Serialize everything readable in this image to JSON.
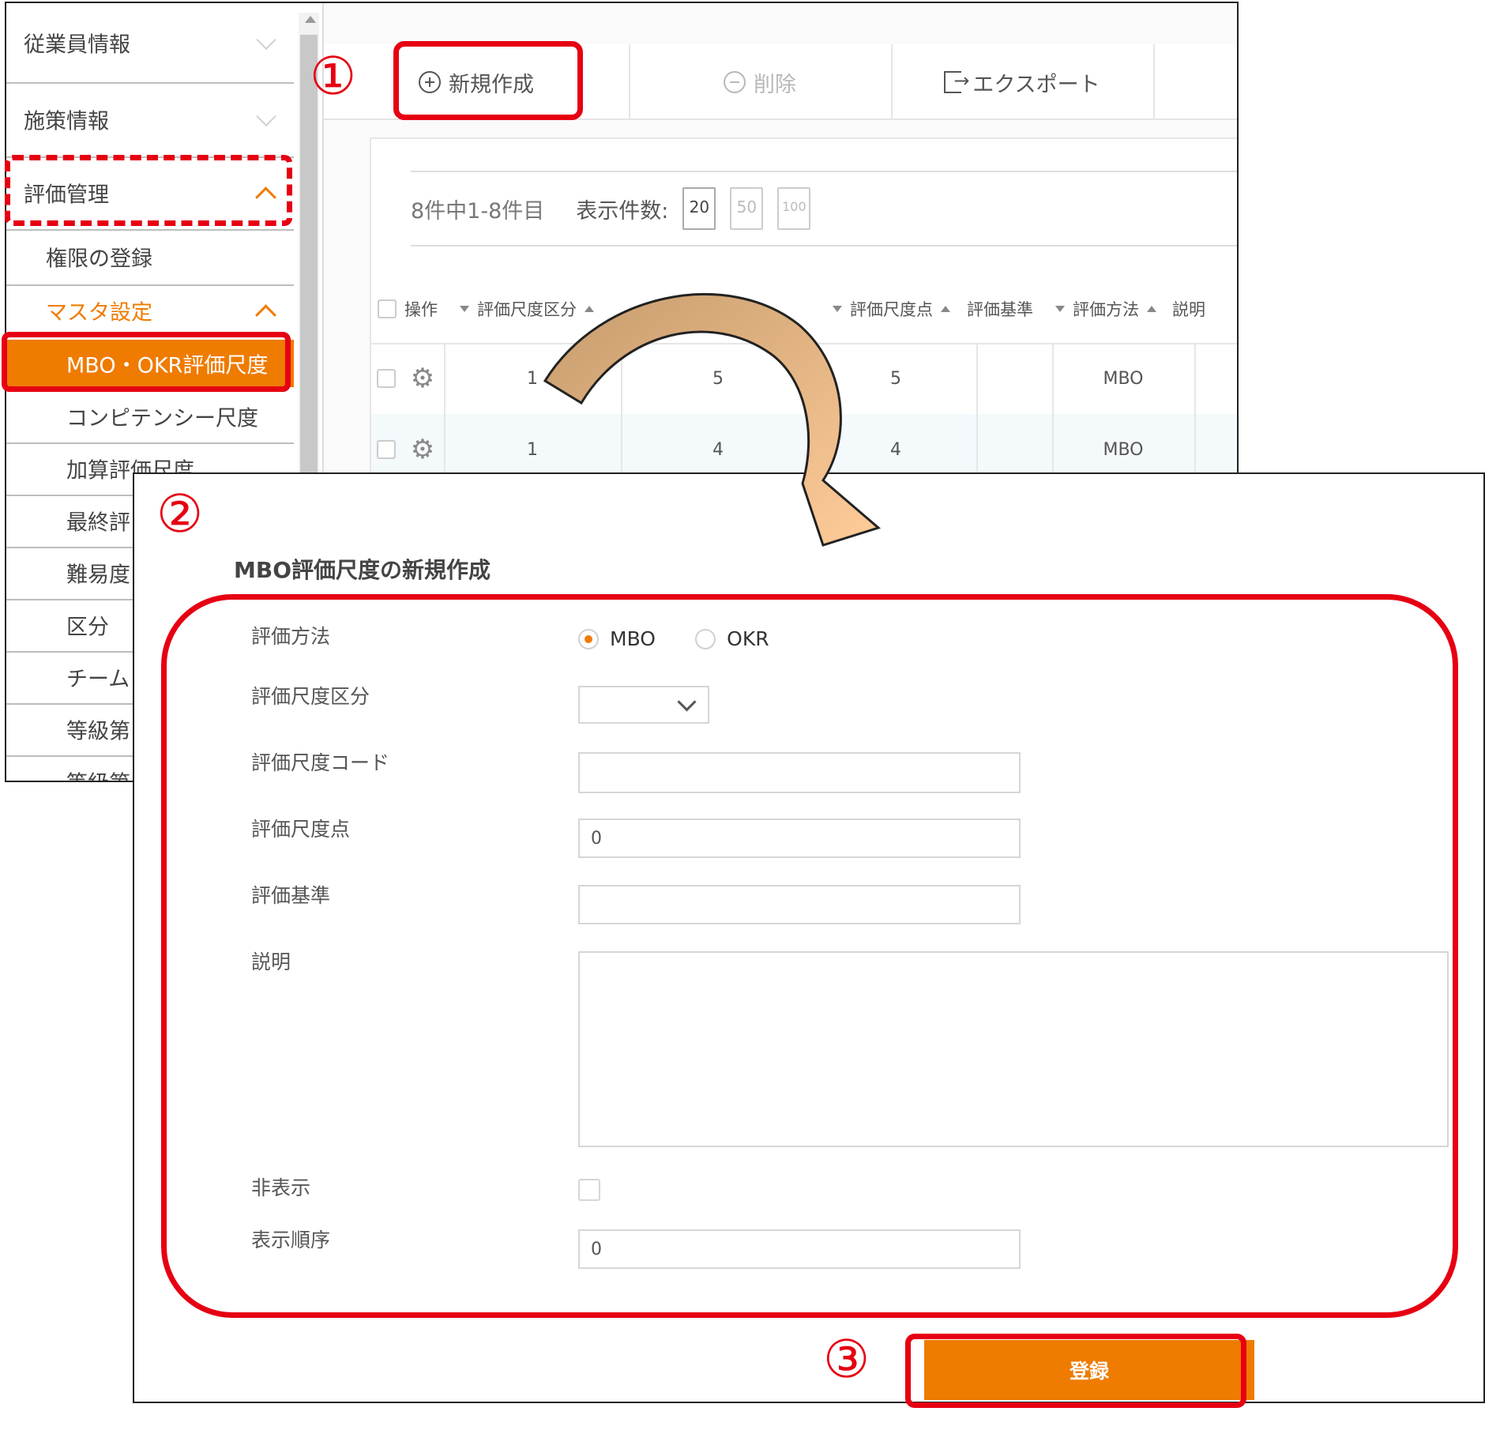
{
  "sidebar": {
    "items": [
      {
        "label": "従業員情報"
      },
      {
        "label": "施策情報"
      },
      {
        "label": "評価管理"
      },
      {
        "label": "権限の登録"
      },
      {
        "label": "マスタ設定"
      },
      {
        "label": "MBO・OKR評価尺度"
      },
      {
        "label": "コンピテンシー尺度"
      },
      {
        "label": "加算評価尺度"
      },
      {
        "label": "最終評"
      },
      {
        "label": "難易度"
      },
      {
        "label": "区分"
      },
      {
        "label": "チーム"
      },
      {
        "label": "等級第"
      },
      {
        "label": "等級第"
      }
    ]
  },
  "toolbar": {
    "new_label": "新規作成",
    "delete_label": "削除",
    "export_label": "エクスポート"
  },
  "list": {
    "count_text": "8件中1-8件目",
    "page_size_label": "表示件数:",
    "page_sizes": [
      "20",
      "50",
      "100"
    ],
    "headers": [
      "操作",
      "評価尺度区分",
      "評価尺度点",
      "評価基準",
      "評価方法",
      "説明"
    ],
    "rows": [
      {
        "cat": "1",
        "code": "5",
        "point": "5",
        "method": "MBO"
      },
      {
        "cat": "1",
        "code": "4",
        "point": "4",
        "method": "MBO"
      }
    ]
  },
  "dialog": {
    "title": "MBO評価尺度の新規作成",
    "method_label": "評価方法",
    "method_options": [
      "MBO",
      "OKR"
    ],
    "category_label": "評価尺度区分",
    "category_value": "",
    "code_label": "評価尺度コード",
    "code_value": "",
    "point_label": "評価尺度点",
    "point_value": "0",
    "criteria_label": "評価基準",
    "criteria_value": "",
    "description_label": "説明",
    "description_value": "",
    "hidden_label": "非表示",
    "order_label": "表示順序",
    "order_value": "0",
    "submit_label": "登録"
  },
  "annotations": {
    "step1": "①",
    "step2": "②",
    "step3": "③",
    "highlight_color": "#e60012",
    "arrow_colors": [
      "#c69c6d",
      "#ffcc99"
    ]
  },
  "colors": {
    "accent": "#ef7b00",
    "border": "#222222"
  }
}
